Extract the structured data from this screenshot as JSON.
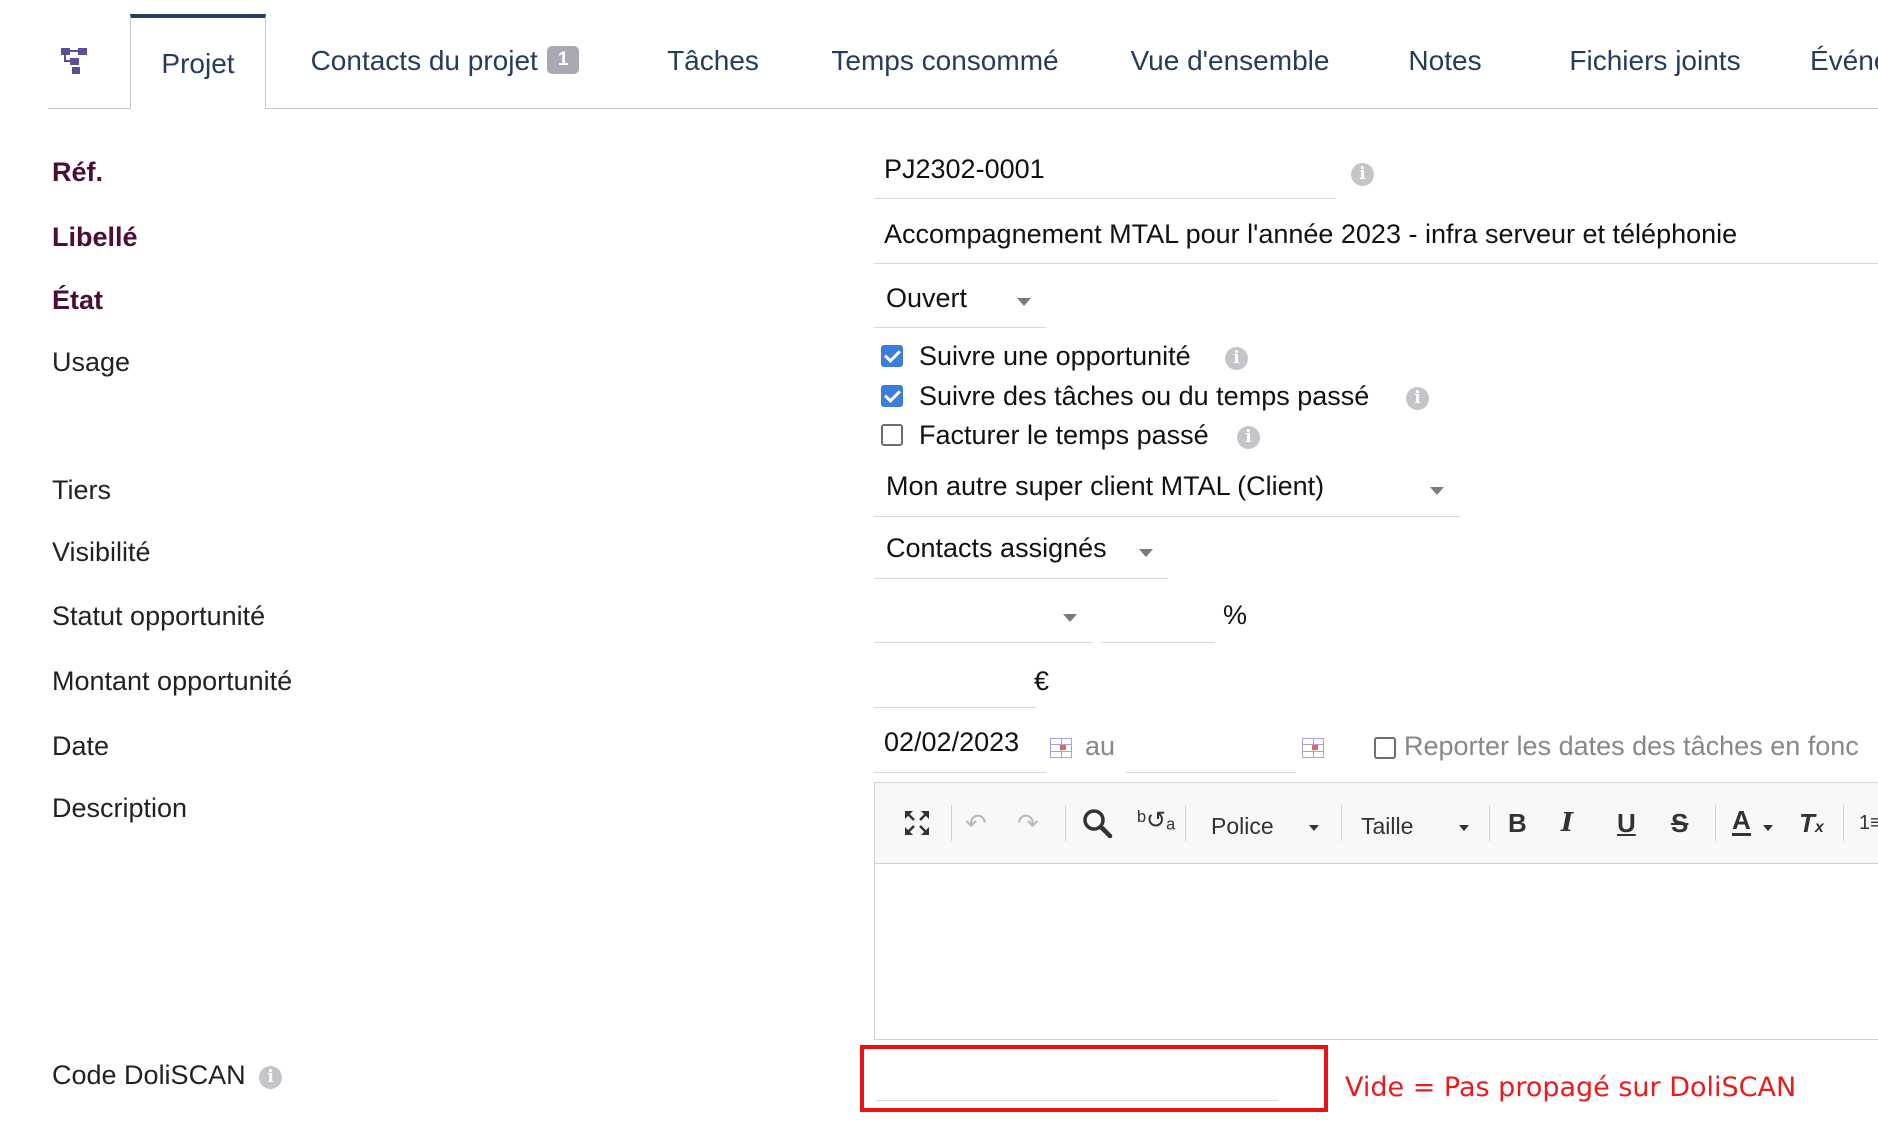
{
  "tabs": [
    {
      "label": "Projet",
      "active": true
    },
    {
      "label": "Contacts du projet",
      "badge": "1"
    },
    {
      "label": "Tâches"
    },
    {
      "label": "Temps consommé"
    },
    {
      "label": "Vue d'ensemble"
    },
    {
      "label": "Notes"
    },
    {
      "label": "Fichiers joints"
    },
    {
      "label": "Événeme"
    }
  ],
  "form": {
    "ref": {
      "label": "Réf.",
      "value": "PJ2302-0001"
    },
    "libelle": {
      "label": "Libellé",
      "value": "Accompagnement MTAL pour l'année 2023 - infra serveur et téléphonie"
    },
    "etat": {
      "label": "État",
      "value": "Ouvert"
    },
    "usage": {
      "label": "Usage",
      "options": [
        {
          "label": "Suivre une opportunité",
          "checked": true
        },
        {
          "label": "Suivre des tâches ou du temps passé",
          "checked": true
        },
        {
          "label": "Facturer le temps passé",
          "checked": false
        }
      ]
    },
    "tiers": {
      "label": "Tiers",
      "value": "Mon autre super client MTAL (Client)"
    },
    "visibilite": {
      "label": "Visibilité",
      "value": "Contacts assignés"
    },
    "statut_opportunite": {
      "label": "Statut opportunité",
      "value": "",
      "percent_value": "",
      "percent_symbol": "%"
    },
    "montant_opportunite": {
      "label": "Montant opportunité",
      "value": "",
      "currency": "€"
    },
    "date": {
      "label": "Date",
      "start": "02/02/2023",
      "to_label": "au",
      "end": "",
      "report_label": "Reporter les dates des tâches en fonc",
      "report_checked": false
    },
    "description": {
      "label": "Description",
      "font_label": "Police",
      "size_label": "Taille",
      "content": ""
    },
    "code_doliscan": {
      "label": "Code DoliSCAN",
      "value": "",
      "note": "Vide = Pas propagé sur DoliSCAN"
    }
  },
  "colors": {
    "accent": "#263c5c",
    "required_label": "#4b0e35",
    "checkbox": "#3b7ddd",
    "highlight": "#ee1111"
  }
}
